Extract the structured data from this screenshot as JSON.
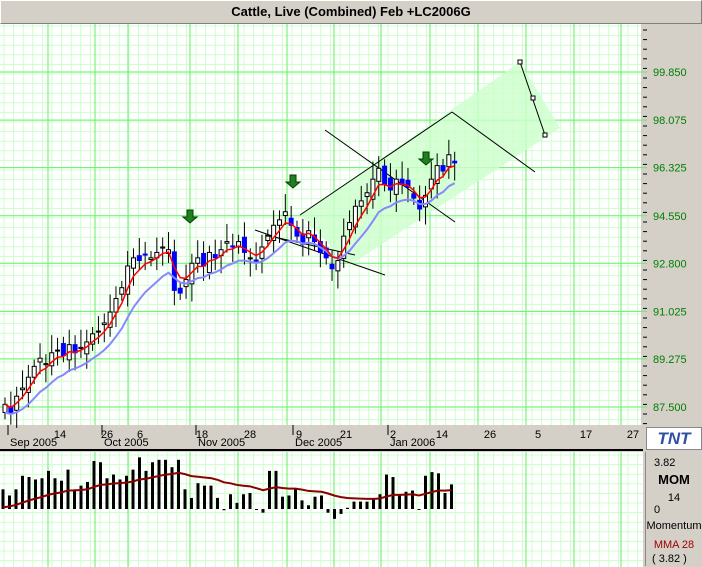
{
  "title": "Cattle, Live (Combined) Feb +LC2006G",
  "logo": "TNT",
  "colors": {
    "grid_major": "#66ee66",
    "grid_minor": "#ccffcc",
    "axis_text": "#008000",
    "fast_ma": "#ff0000",
    "slow_ma": "#8888ff",
    "momentum_ma": "#8b0000",
    "channel": "#ccffcc"
  },
  "chart_data": {
    "type": "candlestick",
    "title": "Cattle, Live (Combined) Feb +LC2006G",
    "y_ticks": [
      "99.850",
      "98.075",
      "96.325",
      "94.550",
      "92.800",
      "91.025",
      "89.275",
      "87.500"
    ],
    "ylim": [
      87.0,
      101.0
    ],
    "x_day_labels": [
      "14",
      "26",
      "6",
      "18",
      "28",
      "9",
      "21",
      "2",
      "14",
      "26",
      "5",
      "17",
      "27"
    ],
    "x_month_labels": [
      "Sep 2005",
      "Oct 2005",
      "Nov 2005",
      "Dec 2005",
      "Jan 2006"
    ],
    "closes": [
      87.6,
      87.3,
      87.9,
      88.2,
      88.6,
      89.0,
      89.3,
      89.1,
      89.5,
      89.6,
      89.4,
      89.8,
      89.5,
      89.7,
      89.9,
      90.2,
      90.3,
      90.6,
      91.0,
      91.5,
      91.9,
      92.7,
      93.0,
      92.9,
      93.1,
      93.0,
      93.2,
      93.4,
      93.3,
      91.8,
      91.7,
      92.2,
      92.8,
      93.0,
      92.7,
      93.2,
      93.0,
      93.3,
      93.6,
      93.4,
      93.6,
      93.2,
      93.0,
      92.9,
      93.4,
      93.8,
      94.2,
      94.4,
      94.7,
      94.2,
      93.8,
      93.5,
      94.0,
      93.6,
      93.2,
      93.0,
      92.6,
      92.9,
      93.8,
      94.3,
      94.9,
      95.1,
      95.4,
      95.9,
      96.3,
      95.7,
      95.5,
      95.9,
      95.7,
      95.6,
      95.2,
      94.8,
      95.3,
      95.9,
      96.4,
      96.2,
      96.8,
      96.5
    ],
    "momentum": {
      "label": "MOM",
      "period": "14",
      "name": "Momentum",
      "ma_label": "MMA 28",
      "top": "3.82",
      "zero": "0",
      "current": "( 3.82 )",
      "values": [
        1.6,
        1.1,
        1.6,
        2.7,
        2.6,
        2.4,
        2.5,
        3.1,
        2.5,
        2.3,
        3.2,
        1.6,
        1.9,
        2.2,
        3.9,
        3.8,
        2.5,
        2.8,
        2.4,
        2.7,
        3.2,
        4.2,
        3.1,
        3.8,
        4.0,
        4.0,
        3.4,
        4.0,
        1.6,
        0.9,
        2.1,
        1.9,
        1.9,
        0.9,
        -0.1,
        1.2,
        0.5,
        1.2,
        1.3,
        0.0,
        -0.3,
        3.1,
        3.1,
        1.0,
        1.1,
        1.6,
        0.7,
        0.3,
        1.0,
        1.1,
        -0.3,
        -0.8,
        -0.4,
        0.1,
        0.6,
        0.6,
        0.6,
        0.8,
        1.2,
        2.8,
        2.6,
        1.2,
        1.4,
        1.5,
        0.0,
        2.7,
        3.0,
        2.9,
        1.3,
        2.0
      ]
    }
  }
}
